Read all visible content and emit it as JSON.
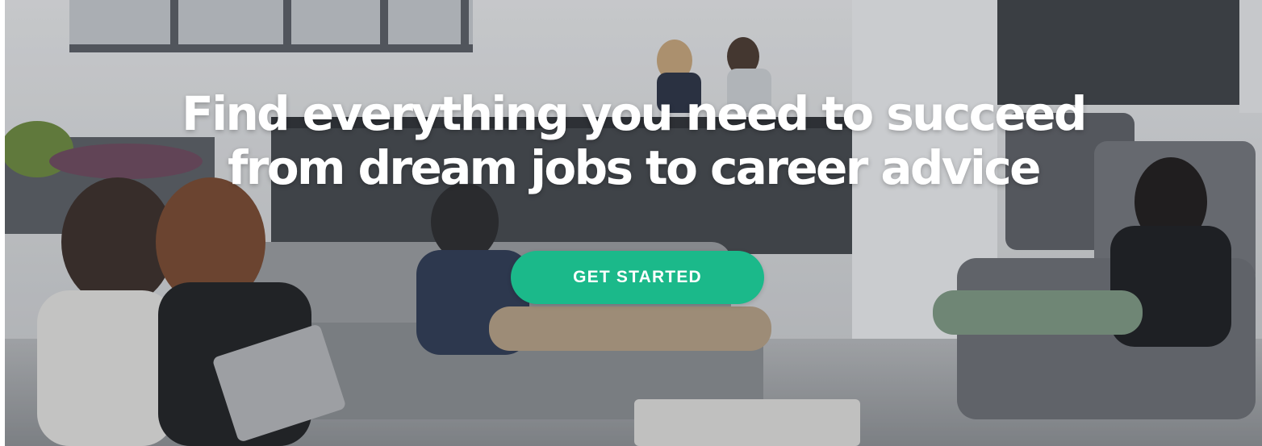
{
  "hero": {
    "headline_line1": "Find everything you need to succeed",
    "headline_line2": "from dream jobs to career advice",
    "cta_label": "GET STARTED",
    "cta_color": "#1bb98a"
  }
}
